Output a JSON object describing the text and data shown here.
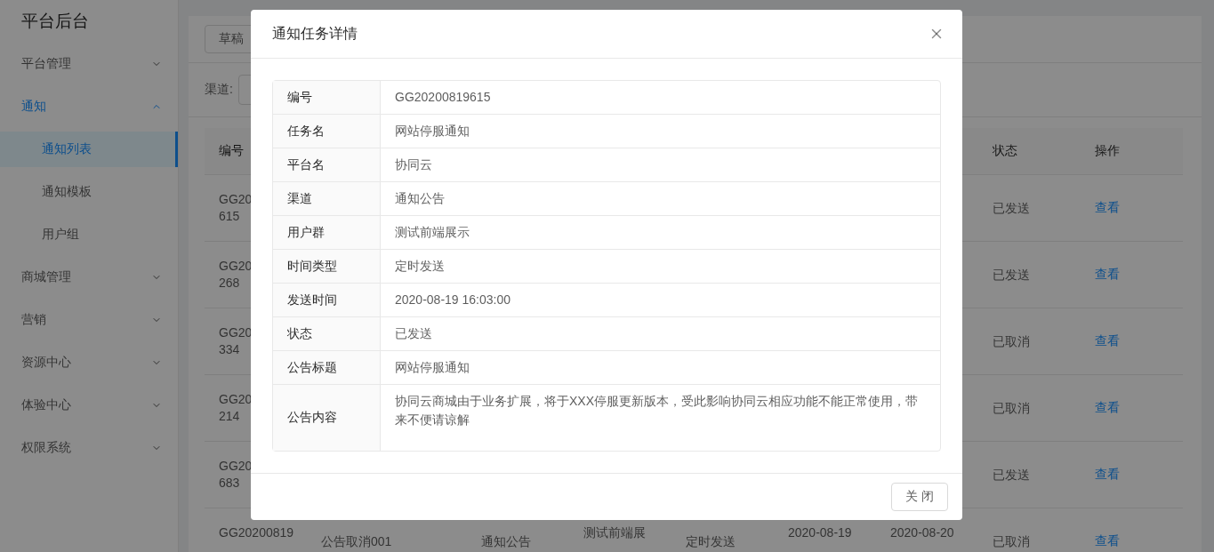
{
  "sidebar": {
    "title": "平台后台",
    "items": [
      {
        "label": "平台管理",
        "expanded": false,
        "selected": false
      },
      {
        "label": "通知",
        "expanded": true,
        "selected": true,
        "children": [
          {
            "label": "通知列表",
            "selected": true
          },
          {
            "label": "通知模板",
            "selected": false
          },
          {
            "label": "用户组",
            "selected": false
          }
        ]
      },
      {
        "label": "商城管理",
        "expanded": false,
        "selected": false
      },
      {
        "label": "营销",
        "expanded": false,
        "selected": false
      },
      {
        "label": "资源中心",
        "expanded": false,
        "selected": false
      },
      {
        "label": "体验中心",
        "expanded": false,
        "selected": false
      },
      {
        "label": "权限系统",
        "expanded": false,
        "selected": false
      }
    ]
  },
  "toolbar": {
    "button": "草稿"
  },
  "filter": {
    "label": "渠道:"
  },
  "table": {
    "header": {
      "id": "编号",
      "status": "状态",
      "action": "操作"
    },
    "rows": [
      {
        "id_lines": [
          "GG20",
          "615"
        ],
        "status": "已发送",
        "action": "查看"
      },
      {
        "id_lines": [
          "GG20",
          "268"
        ],
        "status": "已发送",
        "action": "查看"
      },
      {
        "id_lines": [
          "GG20",
          "334"
        ],
        "status": "已取消",
        "action": "查看"
      },
      {
        "id_lines": [
          "GG20",
          "214"
        ],
        "status": "已取消",
        "action": "查看"
      },
      {
        "id_lines": [
          "GG20",
          "683"
        ],
        "status": "已发送",
        "action": "查看"
      },
      {
        "id_lines": [
          "GG20200819"
        ],
        "task": "公告取消001",
        "channel": "通知公告",
        "group_lines": [
          "测试前端展"
        ],
        "time_type": "定时发送",
        "created_lines": [
          "2020-08-19"
        ],
        "sent_lines": [
          "2020-08-20"
        ],
        "status": "已取消",
        "action": "查看"
      }
    ]
  },
  "modal": {
    "title": "通知任务详情",
    "fields": [
      {
        "label": "编号",
        "value": "GG20200819615"
      },
      {
        "label": "任务名",
        "value": "网站停服通知"
      },
      {
        "label": "平台名",
        "value": "协同云"
      },
      {
        "label": "渠道",
        "value": "通知公告"
      },
      {
        "label": "用户群",
        "value": "测试前端展示"
      },
      {
        "label": "时间类型",
        "value": "定时发送"
      },
      {
        "label": "发送时间",
        "value": "2020-08-19 16:03:00"
      },
      {
        "label": "状态",
        "value": "已发送"
      },
      {
        "label": "公告标题",
        "value": "网站停服通知"
      },
      {
        "label": "公告内容",
        "value": "协同云商城由于业务扩展，将于XXX停服更新版本，受此影响协同云相应功能不能正常使用，带来不便请谅解"
      }
    ],
    "footer_button": "关 闭"
  }
}
